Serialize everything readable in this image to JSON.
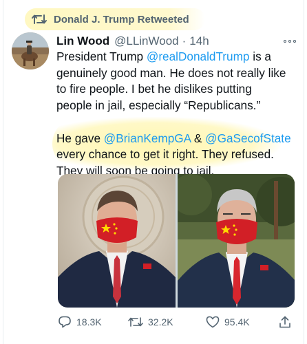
{
  "retweet": {
    "label": "Donald J. Trump Retweeted",
    "icon": "retweet-icon"
  },
  "tweet": {
    "author_name": "Lin Wood",
    "author_handle": "@LLinWood",
    "separator": "·",
    "time": "14h",
    "lines": [
      [
        {
          "t": "President Trump ",
          "link": false
        },
        {
          "t": "@realDonaldTrump",
          "link": true
        },
        {
          "t": " is a",
          "link": false
        }
      ],
      [
        {
          "t": "genuinely good man. He does not really like",
          "link": false
        }
      ],
      [
        {
          "t": "to fire people. I bet he dislikes putting",
          "link": false
        }
      ],
      [
        {
          "t": "people in jail, especially “Republicans.”",
          "link": false
        }
      ],
      [
        {
          "t": "",
          "link": false
        }
      ],
      [
        {
          "t": "He gave ",
          "link": false
        },
        {
          "t": "@BrianKempGA",
          "link": true
        },
        {
          "t": " & ",
          "link": false
        },
        {
          "t": "@GaSecofState",
          "link": true
        }
      ],
      [
        {
          "t": "every chance to get it right. They refused.",
          "link": false
        }
      ],
      [
        {
          "t": "They will soon be going to jail.",
          "link": false
        }
      ]
    ]
  },
  "actions": {
    "reply_count": "18.3K",
    "retweet_count": "32.2K",
    "like_count": "95.4K"
  },
  "icons": [
    "retweet-icon",
    "more-icon",
    "reply-icon",
    "heart-icon",
    "share-icon"
  ],
  "colors": {
    "link": "#1d9bf0",
    "text": "#0f1419",
    "muted": "#536471",
    "highlight": "#fff6af"
  }
}
